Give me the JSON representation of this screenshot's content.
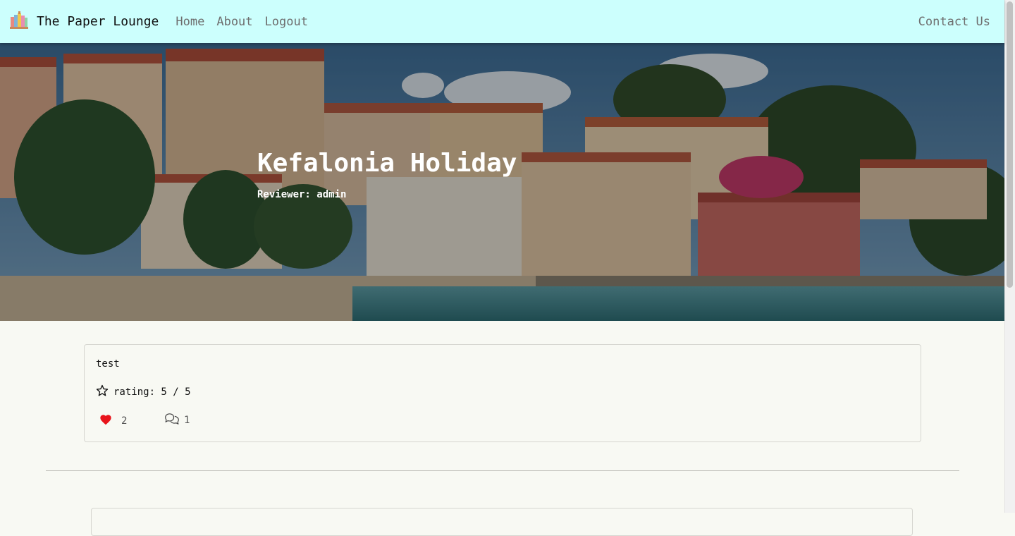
{
  "navbar": {
    "brand": "The Paper Lounge",
    "links": [
      "Home",
      "About",
      "Logout"
    ],
    "contact": "Contact Us"
  },
  "hero": {
    "title": "Kefalonia Holiday",
    "reviewer": "Reviewer: admin"
  },
  "review": {
    "text": "test",
    "rating": "rating: 5 / 5",
    "likes": "2",
    "comments": "1"
  },
  "colors": {
    "navbar_bg": "#ccfffd",
    "page_bg": "#f8f9f3",
    "like_heart": "#e8141b"
  }
}
